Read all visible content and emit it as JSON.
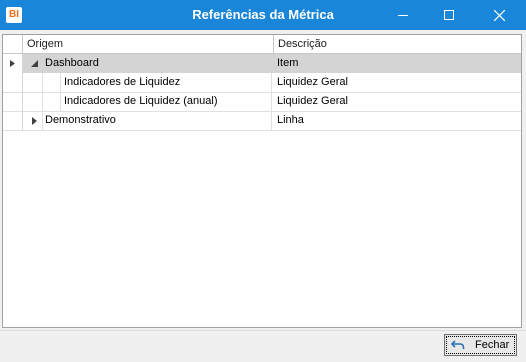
{
  "window": {
    "app_icon_text": "BI",
    "title": "Referências da Métrica"
  },
  "grid": {
    "columns": [
      "Origem",
      "Descrição"
    ],
    "rows": [
      {
        "origem": "Dashboard",
        "descricao": "Item",
        "expanded": true,
        "level": 0,
        "selected": true
      },
      {
        "origem": "Indicadores de Liquidez",
        "descricao": "Liquidez Geral",
        "level": 1
      },
      {
        "origem": "Indicadores de Liquidez (anual)",
        "descricao": "Liquidez Geral",
        "level": 1
      },
      {
        "origem": "Demonstrativo",
        "descricao": "Linha",
        "expanded": false,
        "level": 0
      }
    ]
  },
  "footer": {
    "close_label": "Fechar",
    "close_icon": "undo-arrow-icon"
  },
  "colors": {
    "titlebar": "#1a86d9",
    "selected_row": "#d4d4d4"
  }
}
